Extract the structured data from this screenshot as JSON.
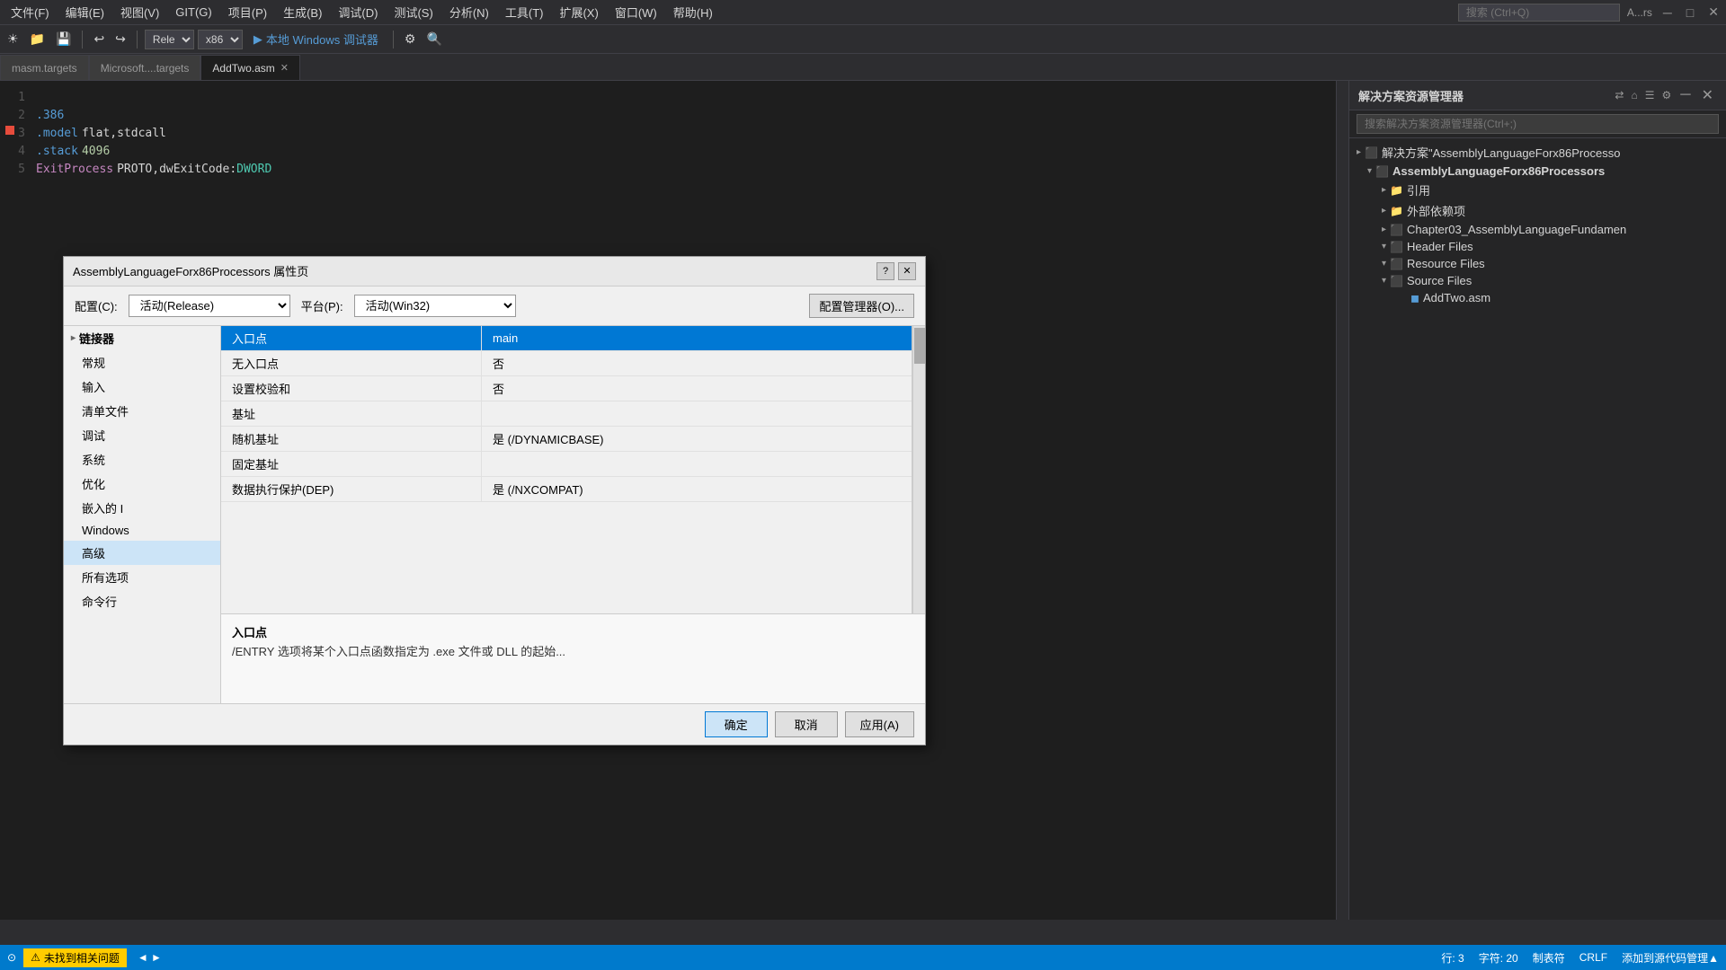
{
  "menubar": {
    "items": [
      {
        "label": "文件(F)"
      },
      {
        "label": "编辑(E)"
      },
      {
        "label": "视图(V)"
      },
      {
        "label": "GIT(G)"
      },
      {
        "label": "项目(P)"
      },
      {
        "label": "生成(B)"
      },
      {
        "label": "调试(D)"
      },
      {
        "label": "测试(S)"
      },
      {
        "label": "分析(N)"
      },
      {
        "label": "工具(T)"
      },
      {
        "label": "扩展(X)"
      },
      {
        "label": "窗口(W)"
      },
      {
        "label": "帮助(H)"
      }
    ],
    "search_placeholder": "搜索 (Ctrl+Q)",
    "user_label": "A...rs"
  },
  "toolbar": {
    "config": "Rele",
    "platform": "x86",
    "run_label": "本地 Windows 调试器"
  },
  "tabs": [
    {
      "label": "masm.targets",
      "active": false,
      "closable": false
    },
    {
      "label": "Microsoft....targets",
      "active": false,
      "closable": false
    },
    {
      "label": "AddTwo.asm",
      "active": true,
      "closable": true
    }
  ],
  "editor": {
    "lines": [
      {
        "num": "1",
        "content": "",
        "type": "plain"
      },
      {
        "num": "2",
        "content": ".386",
        "type": "directive"
      },
      {
        "num": "3",
        "content": ".model flat,stdcall",
        "type": "mixed"
      },
      {
        "num": "4",
        "content": ".stack 4096",
        "type": "mixed"
      },
      {
        "num": "5",
        "content": "ExitProcess PROTO,dwExitCode:DWORD",
        "type": "mixed"
      }
    ]
  },
  "solution_explorer": {
    "title": "解决方案资源管理器",
    "search_placeholder": "搜索解决方案资源管理器(Ctrl+;)",
    "tree": [
      {
        "level": 0,
        "label": "解决方案\"AssemblyLanguageForx86Processo",
        "icon": "solution",
        "expanded": true
      },
      {
        "level": 1,
        "label": "AssemblyLanguageForx86Processors",
        "icon": "project",
        "expanded": true,
        "bold": true
      },
      {
        "level": 2,
        "label": "引用",
        "icon": "folder",
        "expanded": false
      },
      {
        "level": 2,
        "label": "外部依赖项",
        "icon": "folder",
        "expanded": false
      },
      {
        "level": 2,
        "label": "Chapter03_AssemblyLanguageFundamen",
        "icon": "folder",
        "expanded": false
      },
      {
        "level": 2,
        "label": "Header Files",
        "icon": "folder",
        "expanded": false
      },
      {
        "level": 2,
        "label": "Resource Files",
        "icon": "folder",
        "expanded": false
      },
      {
        "level": 2,
        "label": "Source Files",
        "icon": "folder",
        "expanded": false
      },
      {
        "level": 3,
        "label": "AddTwo.asm",
        "icon": "file"
      }
    ]
  },
  "dialog": {
    "title": "AssemblyLanguageForx86Processors 属性页",
    "help_btn": "?",
    "close_btn": "✕",
    "config_label": "配置(C):",
    "config_value": "活动(Release)",
    "platform_label": "平台(P):",
    "platform_value": "活动(Win32)",
    "config_mgr_label": "配置管理器(O)...",
    "sidebar_items": [
      {
        "label": "链接器",
        "level": 0,
        "expanded": true
      },
      {
        "label": "常规",
        "level": 1
      },
      {
        "label": "输入",
        "level": 1
      },
      {
        "label": "清单文件",
        "level": 1
      },
      {
        "label": "调试",
        "level": 1
      },
      {
        "label": "系统",
        "level": 1
      },
      {
        "label": "优化",
        "level": 1
      },
      {
        "label": "嵌入的 I",
        "level": 1
      },
      {
        "label": "Windows",
        "level": 1
      },
      {
        "label": "高级",
        "level": 1,
        "selected": true
      },
      {
        "label": "所有选项",
        "level": 1
      },
      {
        "label": "命令行",
        "level": 1
      }
    ],
    "properties": [
      {
        "name": "入口点",
        "value": "main",
        "selected": true,
        "is_input": true
      },
      {
        "name": "无入口点",
        "value": "否",
        "selected": false
      },
      {
        "name": "设置校验和",
        "value": "否",
        "selected": false
      },
      {
        "name": "基址",
        "value": "",
        "selected": false
      },
      {
        "name": "随机基址",
        "value": "是 (/DYNAMICBASE)",
        "selected": false
      },
      {
        "name": "固定基址",
        "value": "",
        "selected": false
      },
      {
        "name": "数据执行保护(DEP)",
        "value": "是 (/NXCOMPAT)",
        "selected": false
      }
    ],
    "desc_title": "入口点",
    "desc_text": "/ENTRY 选项将某个入口点函数指定为 .exe 文件或 DLL 的起始...",
    "btn_ok": "确定",
    "btn_cancel": "取消",
    "btn_apply": "应用(A)"
  },
  "statusbar": {
    "warning_text": "未找到相关问题",
    "position": "行: 3",
    "char": "字符: 20",
    "line_ending": "制表符",
    "encoding": "CRLF",
    "add_source_text": "添加到源代码管理▲"
  }
}
